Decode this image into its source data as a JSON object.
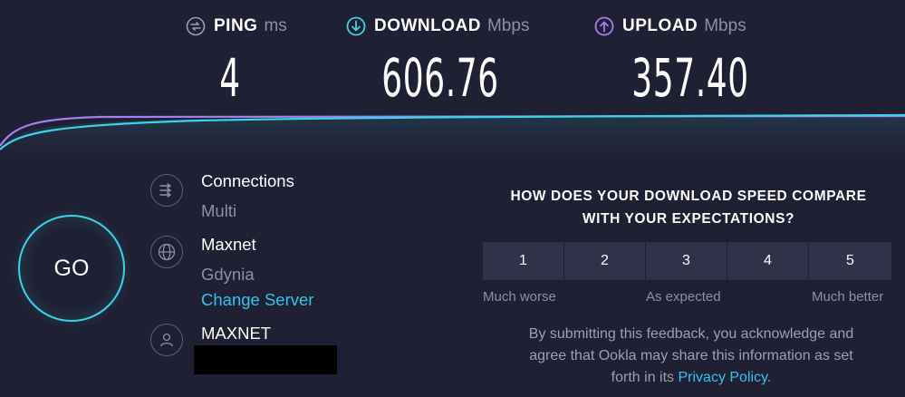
{
  "stats": {
    "ping": {
      "label": "PING",
      "unit": "ms",
      "value": "4",
      "icon": "ping-icon"
    },
    "download": {
      "label": "DOWNLOAD",
      "unit": "Mbps",
      "value": "606.76",
      "icon": "download-arrow-icon"
    },
    "upload": {
      "label": "UPLOAD",
      "unit": "Mbps",
      "value": "357.40",
      "icon": "upload-arrow-icon"
    }
  },
  "colors": {
    "background": "#1f2033",
    "download": "#3cd3e6",
    "upload": "#a77ef0",
    "link": "#2fc6ec"
  },
  "go_button": {
    "label": "GO"
  },
  "connections": {
    "title": "Connections",
    "value": "Multi",
    "icon": "connections-icon"
  },
  "server": {
    "title": "Maxnet",
    "location": "Gdynia",
    "change_link": "Change Server",
    "icon": "globe-icon"
  },
  "provider": {
    "title": "MAXNET",
    "icon": "user-icon"
  },
  "feedback": {
    "question_line1": "HOW DOES YOUR DOWNLOAD SPEED COMPARE",
    "question_line2": "WITH YOUR EXPECTATIONS?",
    "ratings": [
      "1",
      "2",
      "3",
      "4",
      "5"
    ],
    "scale_low": "Much worse",
    "scale_mid": "As expected",
    "scale_high": "Much better",
    "disclaimer_line1": "By submitting this feedback, you acknowledge and",
    "disclaimer_line2": "agree that Ookla may share this information as set",
    "disclaimer_line3_prefix": "forth in its",
    "privacy_link": "Privacy Policy",
    "disclaimer_suffix": "."
  }
}
